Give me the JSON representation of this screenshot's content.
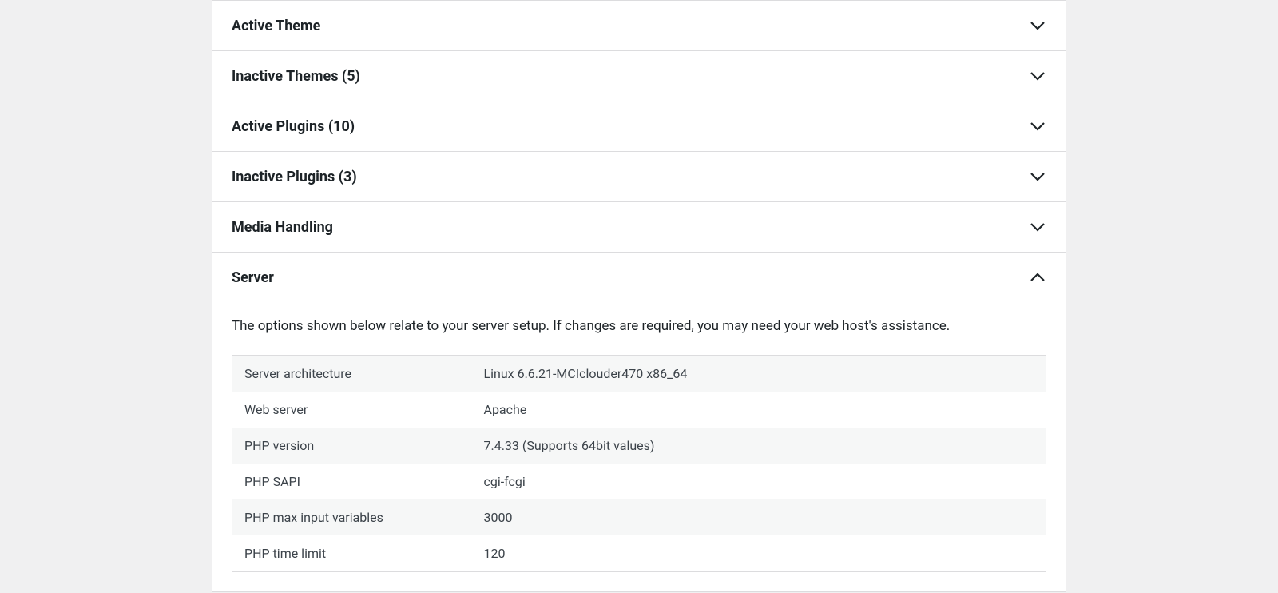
{
  "panels": {
    "active_theme": {
      "title": "Active Theme"
    },
    "inactive_themes": {
      "title": "Inactive Themes (5)"
    },
    "active_plugins": {
      "title": "Active Plugins (10)"
    },
    "inactive_plugins": {
      "title": "Inactive Plugins (3)"
    },
    "media_handling": {
      "title": "Media Handling"
    },
    "server": {
      "title": "Server",
      "description": "The options shown below relate to your server setup. If changes are required, you may need your web host's assistance.",
      "rows": [
        {
          "label": "Server architecture",
          "value": "Linux 6.6.21-MCIclouder470 x86_64"
        },
        {
          "label": "Web server",
          "value": "Apache"
        },
        {
          "label": "PHP version",
          "value": "7.4.33 (Supports 64bit values)"
        },
        {
          "label": "PHP SAPI",
          "value": "cgi-fcgi"
        },
        {
          "label": "PHP max input variables",
          "value": "3000"
        },
        {
          "label": "PHP time limit",
          "value": "120"
        }
      ]
    }
  }
}
